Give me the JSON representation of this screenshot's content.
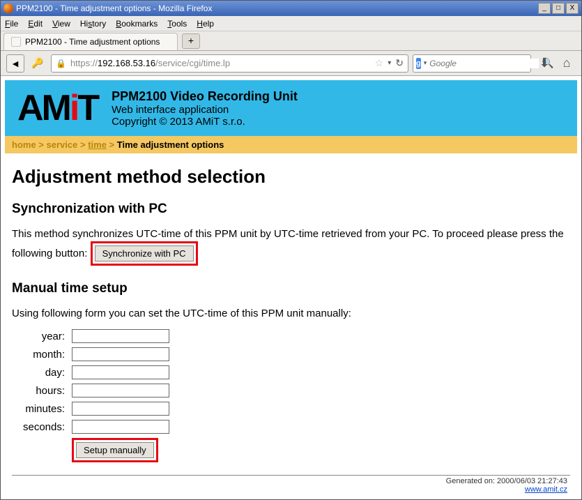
{
  "window": {
    "title": "PPM2100 - Time adjustment options - Mozilla Firefox"
  },
  "menubar": [
    "File",
    "Edit",
    "View",
    "History",
    "Bookmarks",
    "Tools",
    "Help"
  ],
  "tab": {
    "title": "PPM2100 - Time adjustment options"
  },
  "url": {
    "protocol": "https://",
    "host": "192.168.53.16",
    "path": "/service/cgi/time.lp"
  },
  "search": {
    "engine_letter": "g",
    "placeholder": "Google"
  },
  "header": {
    "logo_text": "AMiT",
    "title": "PPM2100 Video Recording Unit",
    "subtitle": "Web interface application",
    "copyright": "Copyright © 2013 AMiT s.r.o."
  },
  "breadcrumb": {
    "home": "home",
    "service": "service",
    "time": "time",
    "current": "Time adjustment options"
  },
  "body": {
    "h1": "Adjustment method selection",
    "h2_sync": "Synchronization with PC",
    "p_sync": "This method synchronizes UTC-time of this PPM unit by UTC-time retrieved from your PC. To proceed please press the following button:",
    "btn_sync": "Synchronize with PC",
    "h2_manual": "Manual time setup",
    "p_manual": "Using following form you can set the UTC-time of this PPM unit manually:",
    "labels": {
      "year": "year:",
      "month": "month:",
      "day": "day:",
      "hours": "hours:",
      "minutes": "minutes:",
      "seconds": "seconds:"
    },
    "btn_manual": "Setup manually"
  },
  "footer": {
    "generated": "Generated on: 2000/06/03 21:27:43",
    "link": "www.amit.cz"
  },
  "win_buttons": {
    "min": "_",
    "max": "□",
    "close": "X"
  }
}
